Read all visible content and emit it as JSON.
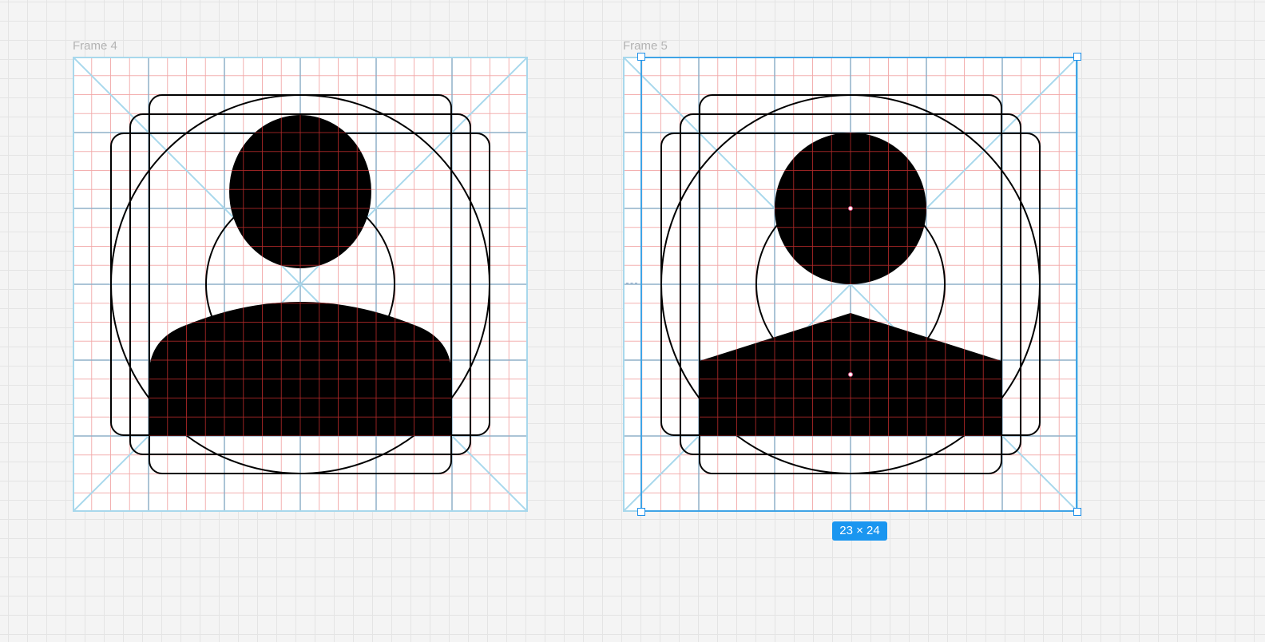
{
  "canvas": {
    "frames": [
      {
        "label": "Frame 4",
        "icon": "person-icon-rounded"
      },
      {
        "label": "Frame 5",
        "icon": "person-icon-geometric"
      }
    ],
    "selection": {
      "frame": "Frame 5",
      "size_label": "23 × 24",
      "selection_color": "#3fa4e6",
      "badge_color": "#1a96f0"
    },
    "grid_colors": {
      "fine": "#f2a8a8",
      "major": "#8fb0c8",
      "keyline": "#a8d8ec",
      "shape_fill": "#000000",
      "overlay_grid": "#b02828"
    }
  }
}
